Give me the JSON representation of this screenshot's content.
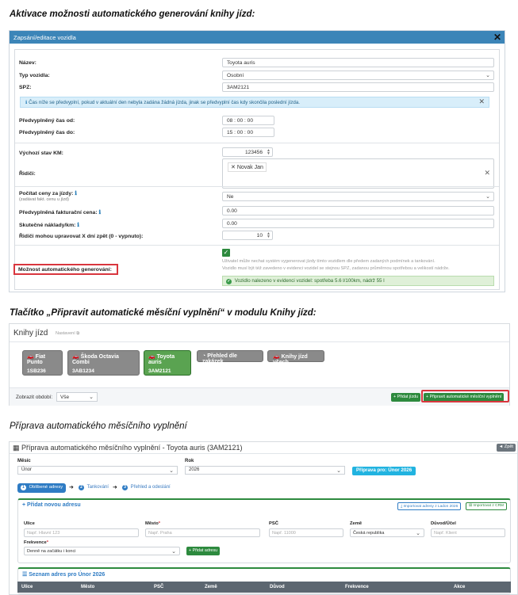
{
  "headings": {
    "h1": "Aktivace možnosti automatického generování knihy jízd:",
    "h2": "Tlačítko „Připravit automatické měsíční vyplnění“ v modulu Knihy jízd:",
    "h3": "Příprava automatického měsíčního vyplnění"
  },
  "modal": {
    "title": "Zapsání/editace vozidla",
    "close": "✕",
    "name_label": "Název:",
    "name_value": "Toyota auris",
    "type_label": "Typ vozidla:",
    "type_value": "Osobní",
    "spz_label": "SPZ:",
    "spz_value": "3AM2121",
    "info_text": "Čas níže se předvyplní, pokud v aktuální den nebyla zadána žádná jízda, jinak se předvyplní čas kdy skončila poslední jízda.",
    "time_from_label": "Předvyplněný čas od:",
    "time_from_value": "08 : 00 : 00",
    "time_to_label": "Předvyplněný čas do:",
    "time_to_value": "15 : 00 : 00",
    "km_label": "Výchozí stav KM:",
    "km_value": "123456",
    "driver_label": "Řidiči:",
    "driver_tag": "Novak Jan",
    "price_label": "Počítat ceny za jízdy:",
    "price_sub": "(zadávat fakt. cenu u jízd)",
    "price_value": "Ne",
    "invoice_label": "Předvyplněná fakturační cena:",
    "invoice_value": "0.00",
    "cost_label": "Skutečné náklady/km:",
    "cost_value": "0.00",
    "days_label": "Řidiči mohou upravovat X dní zpět (0 - vypnuto):",
    "days_value": "10",
    "gen_label": "Možnost automatického generování:",
    "gen_help_1": "Uživatel může nechat systém vygenerovat jízdy tímto vozidlem dle předem zadaných podmínek a tankování.",
    "gen_help_2": "Vozidlo musí být též zavedeno v evidenci vozidel se stejnou SPZ, zadanou průměrnou spotřebou a velikostí nádrže.",
    "gen_success": "Vozidlo nalezeno v evidenci vozidel: spotřeba 5.6 l/100km, nádrž 55 l"
  },
  "knihy": {
    "title": "Knihy jízd",
    "settings": "Nastavení",
    "vehicles": [
      {
        "name": "Fiat Punto",
        "spz": "1SB236"
      },
      {
        "name": "Škoda Octavia Combi",
        "spz": "3AB1234"
      },
      {
        "name": "Toyota auris",
        "spz": "3AM2121"
      }
    ],
    "btn_prehled": "Přehled dle zakázek",
    "btn_vsech": "Knihy jízd všech",
    "period_label": "Zobrazit období:",
    "period_value": "Vše",
    "btn_pridat": "+ Přidat jízdu",
    "btn_pripravit": "+ Připravit automatické měsíční vyplnění"
  },
  "priprava": {
    "title": "Příprava automatického měsíčního vyplnění - Toyota auris (3AM2121)",
    "back": "◄ Zpět",
    "month_label": "Měsíc",
    "month_value": "Únor",
    "year_label": "Rok",
    "year_value": "2026",
    "badge": "Příprava pro: Únor 2026",
    "step1": "Oblíbené adresy",
    "step2": "Tankování",
    "step3": "Přehled a odeslání",
    "add_title": "+ Přidat novou adresu",
    "import_ladon": "Importovat adresy z Ladon 2026",
    "import_crm": "Importovat z CRM",
    "ulice_label": "Ulice",
    "ulice_ph": "Např. Hlavní 123",
    "mesto_label": "Město",
    "mesto_ph": "Např. Praha",
    "psc_label": "PSČ",
    "psc_ph": "Např. 11000",
    "zeme_label": "Země",
    "zeme_value": "Česká republika",
    "duvod_label": "Důvod/Účel",
    "duvod_ph": "Např. Klient",
    "frekvence_label": "Frekvence",
    "frekvence_value": "Denně na začátku i konci",
    "add_btn": "+ Přidat adresu",
    "list_title": "Seznam adres pro Únor 2026",
    "columns": [
      "Ulice",
      "Město",
      "PSČ",
      "Země",
      "Důvod",
      "Frekvence",
      "Akce"
    ]
  },
  "colors": {
    "modal_header": "#3c85b8",
    "active_vehicle": "#5aa351",
    "green_button": "#2d8a3e",
    "highlight": "#d9363e",
    "badge": "#21b3e0"
  }
}
